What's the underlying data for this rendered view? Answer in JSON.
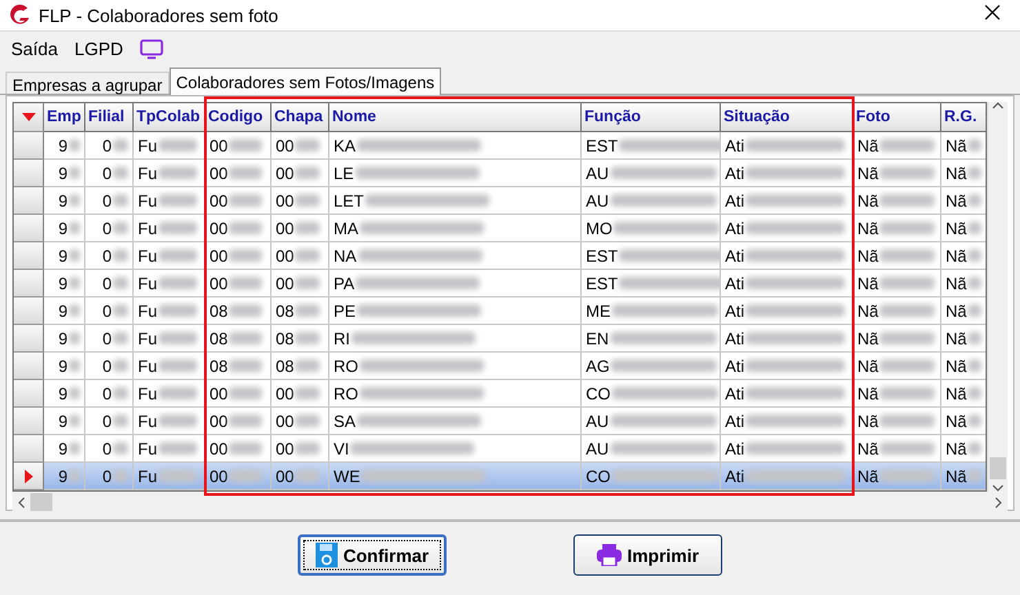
{
  "window": {
    "title": "FLP - Colaboradores sem foto"
  },
  "menu": [
    {
      "label": "Saída",
      "kind": "text"
    },
    {
      "label": "LGPD",
      "kind": "text"
    },
    {
      "kind": "icon"
    }
  ],
  "tabs": [
    {
      "label": "Empresas a agrupar",
      "selected": false
    },
    {
      "label": "Colaboradores sem Fotos/Imagens",
      "selected": true
    }
  ],
  "table": {
    "columns": [
      {
        "label": "Emp",
        "highlighted": false
      },
      {
        "label": "Filial",
        "highlighted": false
      },
      {
        "label": "TpColab",
        "highlighted": false
      },
      {
        "label": "Codigo",
        "highlighted": true
      },
      {
        "label": "Chapa",
        "highlighted": true
      },
      {
        "label": "Nome",
        "highlighted": true
      },
      {
        "label": "Função",
        "highlighted": true
      },
      {
        "label": "Situação",
        "highlighted": true
      },
      {
        "label": "Foto",
        "highlighted": false
      },
      {
        "label": "R.G.",
        "highlighted": false
      }
    ],
    "rows": [
      {
        "selected": false,
        "cells": [
          "9",
          "0",
          "Fu",
          "00",
          "00",
          "KA",
          "EST",
          "Ati",
          "Nã",
          "Nã"
        ]
      },
      {
        "selected": false,
        "cells": [
          "9",
          "0",
          "Fu",
          "00",
          "00",
          "LE",
          "AU",
          "Ati",
          "Nã",
          "Nã"
        ]
      },
      {
        "selected": false,
        "cells": [
          "9",
          "0",
          "Fu",
          "00",
          "00",
          "LET",
          "AU",
          "Ati",
          "Nã",
          "Nã"
        ]
      },
      {
        "selected": false,
        "cells": [
          "9",
          "0",
          "Fu",
          "00",
          "00",
          "MA",
          "MO",
          "Ati",
          "Nã",
          "Nã"
        ]
      },
      {
        "selected": false,
        "cells": [
          "9",
          "0",
          "Fu",
          "00",
          "00",
          "NA",
          "EST",
          "Ati",
          "Nã",
          "Nã"
        ]
      },
      {
        "selected": false,
        "cells": [
          "9",
          "0",
          "Fu",
          "00",
          "00",
          "PA",
          "EST",
          "Ati",
          "Nã",
          "Nã"
        ]
      },
      {
        "selected": false,
        "cells": [
          "9",
          "0",
          "Fu",
          "08",
          "08",
          "PE",
          "ME",
          "Ati",
          "Nã",
          "Nã"
        ]
      },
      {
        "selected": false,
        "cells": [
          "9",
          "0",
          "Fu",
          "08",
          "08",
          "RI",
          "EN",
          "Ati",
          "Nã",
          "Nã"
        ]
      },
      {
        "selected": false,
        "cells": [
          "9",
          "0",
          "Fu",
          "08",
          "08",
          "RO",
          "AG",
          "Ati",
          "Nã",
          "Nã"
        ]
      },
      {
        "selected": false,
        "cells": [
          "9",
          "0",
          "Fu",
          "00",
          "00",
          "RO",
          "CO",
          "Ati",
          "Nã",
          "Nã"
        ]
      },
      {
        "selected": false,
        "cells": [
          "9",
          "0",
          "Fu",
          "00",
          "00",
          "SA",
          "AU",
          "Ati",
          "Nã",
          "Nã"
        ]
      },
      {
        "selected": false,
        "cells": [
          "9",
          "0",
          "Fu",
          "00",
          "00",
          "VI",
          "AU",
          "Ati",
          "Nã",
          "Nã"
        ]
      },
      {
        "selected": true,
        "cells": [
          "9",
          "0",
          "Fu",
          "00",
          "00",
          "WE",
          "CO",
          "Ati",
          "Nã",
          "Nã"
        ]
      }
    ]
  },
  "buttons": [
    {
      "label": "Confirmar",
      "kind": "save",
      "focused": true
    },
    {
      "label": "Imprimir",
      "kind": "print",
      "focused": false
    }
  ]
}
